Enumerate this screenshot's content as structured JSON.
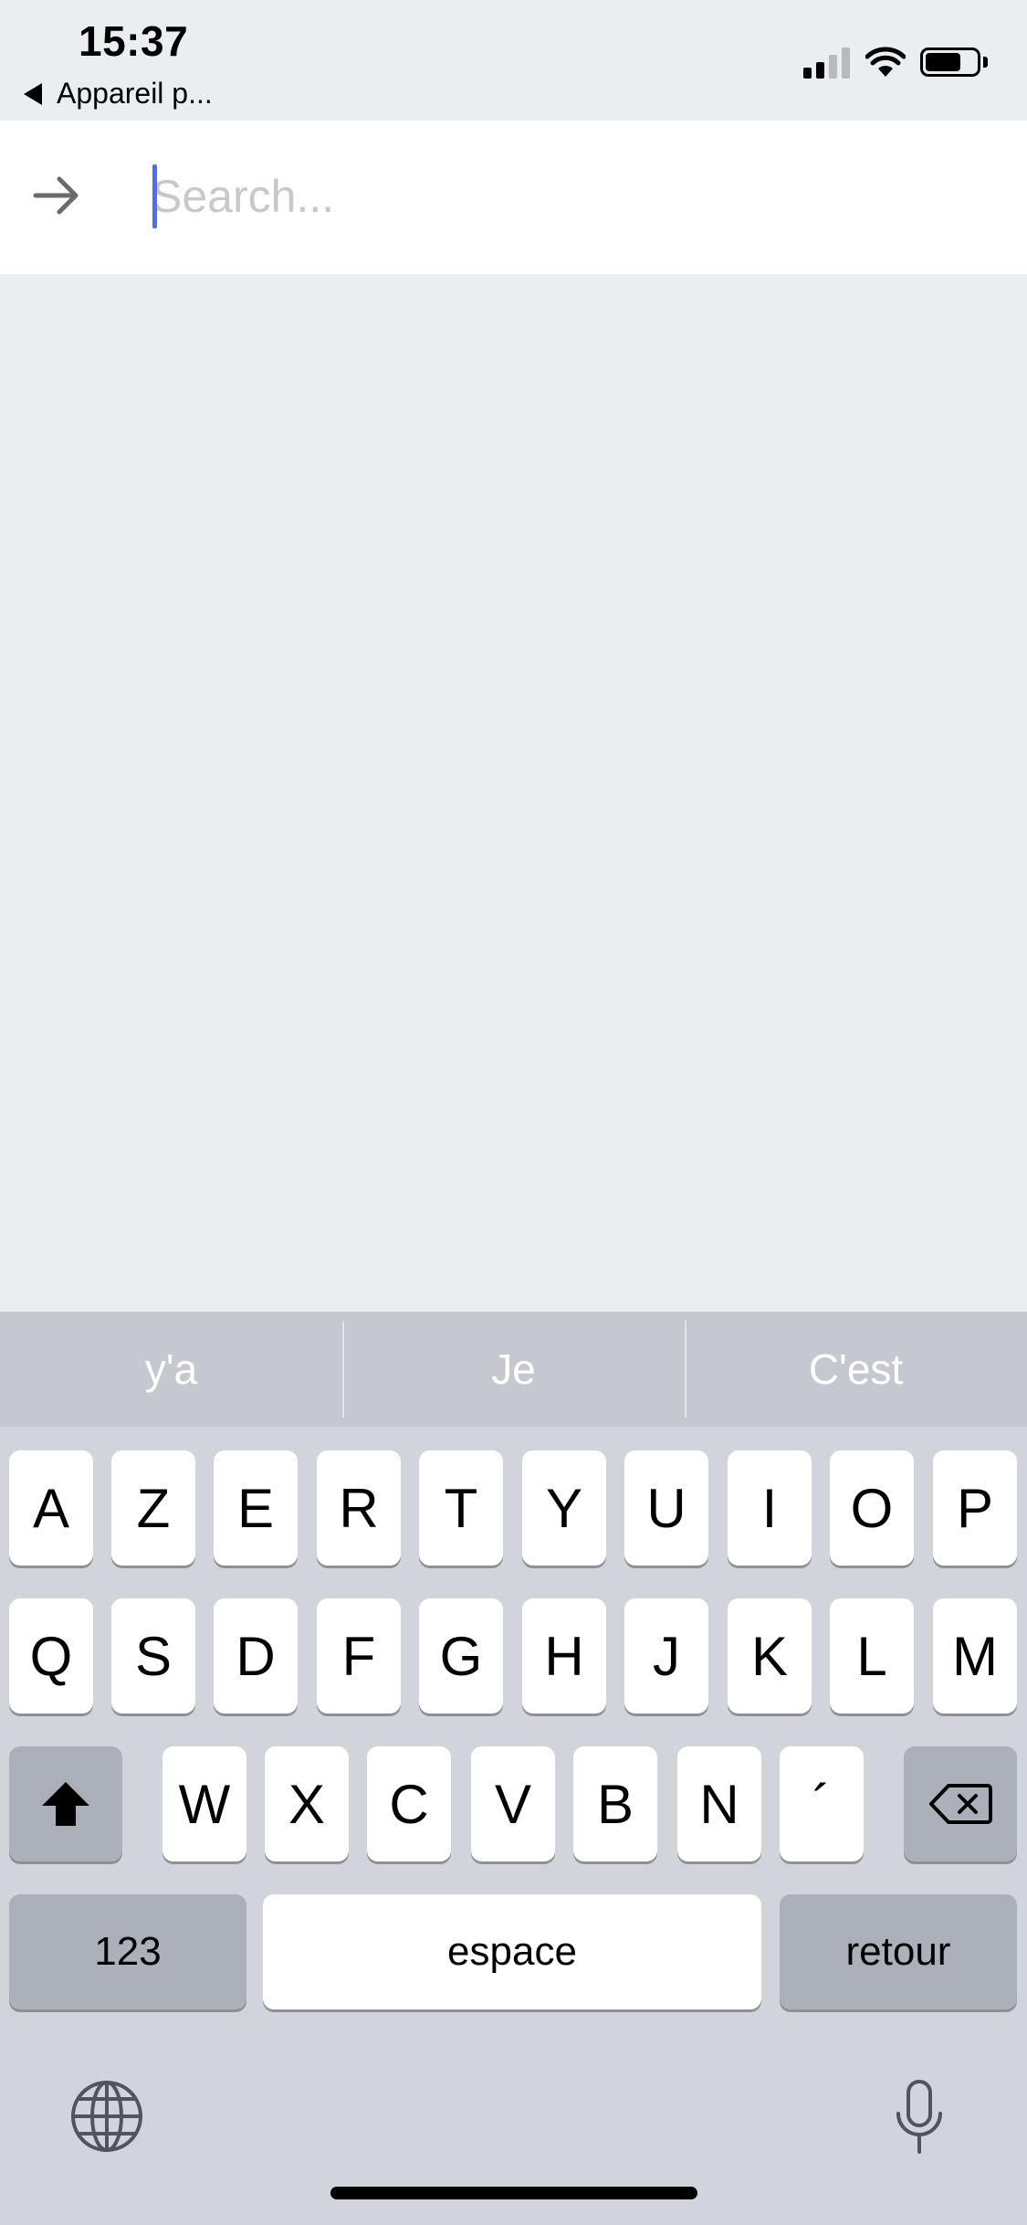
{
  "status_bar": {
    "time": "15:37",
    "back_app_label": "Appareil p...",
    "signal_bars_active": 2,
    "signal_bars_total": 4,
    "battery_level": 0.7
  },
  "search": {
    "placeholder": "Search...",
    "value": "",
    "submit_icon": "arrow-right-icon"
  },
  "keyboard": {
    "suggestions": [
      "y'a",
      "Je",
      "C'est"
    ],
    "row1": [
      "A",
      "Z",
      "E",
      "R",
      "T",
      "Y",
      "U",
      "I",
      "O",
      "P"
    ],
    "row2": [
      "Q",
      "S",
      "D",
      "F",
      "G",
      "H",
      "J",
      "K",
      "L",
      "M"
    ],
    "row3": [
      "W",
      "X",
      "C",
      "V",
      "B",
      "N",
      "´"
    ],
    "numbers_label": "123",
    "space_label": "espace",
    "return_label": "retour",
    "shift_icon": "shift-icon",
    "delete_icon": "delete-icon",
    "globe_icon": "globe-icon",
    "mic_icon": "microphone-icon"
  },
  "colors": {
    "background": "#eaeef1",
    "caret": "#4b6ef5",
    "keyboard_bg": "#d1d4da",
    "key_dark": "#abb0ba"
  }
}
